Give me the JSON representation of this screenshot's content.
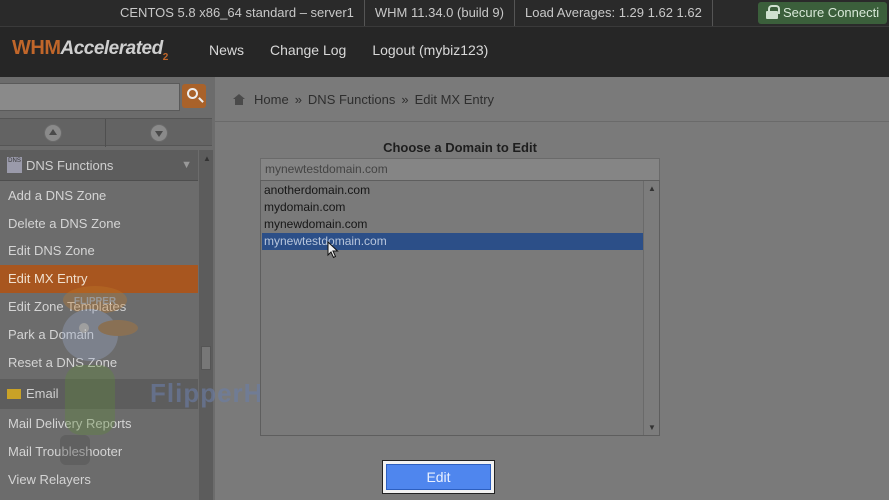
{
  "status_bar": {
    "server": "CENTOS 5.8 x86_64 standard – server1",
    "whm_version": "WHM 11.34.0 (build 9)",
    "load": "Load Averages: 1.29 1.62 1.62",
    "secure": "Secure Connecti"
  },
  "header": {
    "logo_whm": "WHM",
    "logo_accelerated": "Accelerated",
    "logo_2": "2",
    "nav": [
      "News",
      "Change Log",
      "Logout (mybiz123)"
    ]
  },
  "sidebar": {
    "group_title": "DNS Functions",
    "group_icon": "DNS",
    "items": [
      "Add a DNS Zone",
      "Delete a DNS Zone",
      "Edit DNS Zone",
      "Edit MX Entry",
      "Edit Zone Templates",
      "Park a Domain",
      "Reset a DNS Zone"
    ],
    "active_index": 3,
    "email_group": "Email",
    "email_items": [
      "Mail Delivery Reports",
      "Mail Troubleshooter",
      "View Relayers"
    ]
  },
  "watermark": {
    "mascot_text": "FLIPPER",
    "brand": "FlipperHost"
  },
  "breadcrumb": {
    "items": [
      "Home",
      "DNS Functions",
      "Edit MX Entry"
    ],
    "separator": "»"
  },
  "main": {
    "title": "Choose a Domain to Edit",
    "input_value": "mynewtestdomain.com",
    "domains": [
      "anotherdomain.com",
      "mydomain.com",
      "mynewdomain.com",
      "mynewtestdomain.com"
    ],
    "selected_index": 3,
    "edit_label": "Edit"
  },
  "colors": {
    "accent_orange": "#a8561f",
    "selection_blue": "#2c4f88",
    "edit_button": "#4f86ee"
  }
}
